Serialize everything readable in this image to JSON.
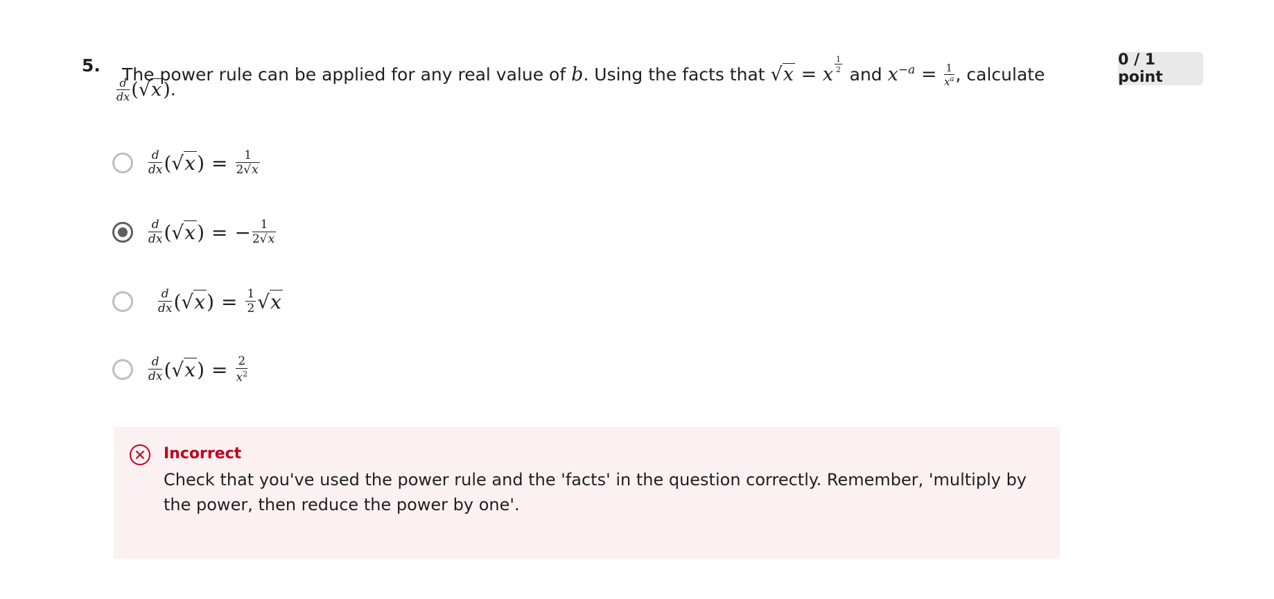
{
  "question": {
    "number": "5.",
    "text_intro": "The power rule can be applied for any real value of",
    "var_b": "b",
    "text_facts": ". Using the facts that",
    "text_and": "and",
    "text_calculate": ", calculate",
    "text_end": "."
  },
  "points": {
    "label": "0 / 1 point"
  },
  "options": [
    {
      "id": "opt-1",
      "selected": false,
      "rhs": "1/(2√x)"
    },
    {
      "id": "opt-2",
      "selected": true,
      "rhs": "-1/(2√x)"
    },
    {
      "id": "opt-3",
      "selected": false,
      "rhs": "(1/2)√x"
    },
    {
      "id": "opt-4",
      "selected": false,
      "rhs": "2/x^2"
    }
  ],
  "feedback": {
    "status": "Incorrect",
    "message": "Check that you've used the power rule and the 'facts' in the question correctly.  Remember, 'multiply by the power, then reduce the power by one'."
  },
  "colors": {
    "incorrect": "#c2001a",
    "feedback_bg": "#fcf1f2",
    "badge_bg": "#e9e9e9",
    "radio_selected": "#5f5f5f",
    "radio_unselected": "#bdbdbd"
  },
  "icons": {
    "feedback_icon": "circle-x-icon"
  }
}
